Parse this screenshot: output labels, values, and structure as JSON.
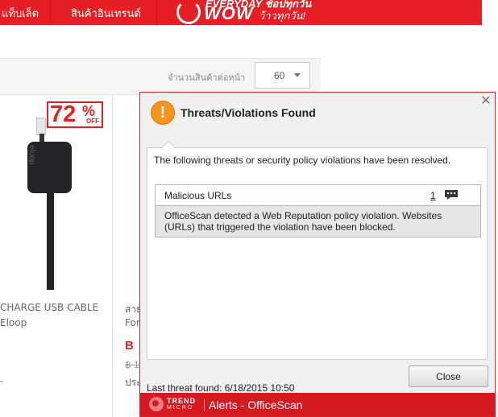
{
  "nav": {
    "items": [
      "แท็บเล็ต",
      "สินค้าอินเทรนด์"
    ],
    "banner": {
      "top": "EVERYDAY ช้อปทุกวัน",
      "main": "WOW",
      "sub": "ว้าวทุกวัน!"
    }
  },
  "toolbar": {
    "per_page_label": "จำนวนสินค้าต่อหน้า",
    "per_page_value": "60"
  },
  "products": [
    {
      "discount_value": "72",
      "discount_pct": "%",
      "discount_off": "OFF",
      "brand_print": "eloop",
      "name": "CHARGE USB CABLE",
      "brand": "Eloop",
      "extra": "-"
    },
    {
      "name": "สาย",
      "brand": "For",
      "price": "B",
      "old_price": "฿ 1",
      "saving": "ประ"
    }
  ],
  "popup": {
    "title": "Threats/Violations Found",
    "close_glyph": "✕",
    "warning_glyph": "!",
    "intro": "The following threats or security policy violations have been resolved.",
    "threat": {
      "name": "Malicious URLs",
      "count": "1",
      "description": "OfficeScan detected a Web Reputation policy violation. Websites (URLs) that triggered the violation have been blocked."
    },
    "last_found": "Last threat found: 6/18/2015 10:50",
    "close_button": "Close",
    "footer": {
      "brand_line1": "TREND",
      "brand_line2": "MICRO",
      "title": "Alerts - OfficeScan"
    }
  },
  "colors": {
    "brand_red": "#e61e25",
    "footer_red": "#d71921",
    "warning_orange": "#f7941d"
  },
  "icons": [
    "clock-icon",
    "dropdown-arrow-icon",
    "warning-icon",
    "close-icon",
    "comment-icon",
    "trend-micro-logo-icon"
  ]
}
